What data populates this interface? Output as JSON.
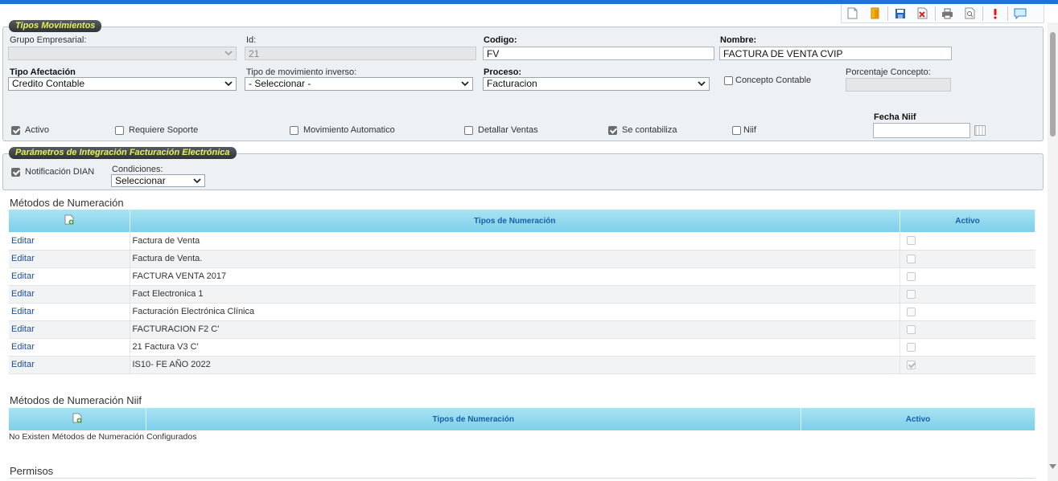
{
  "toolbar": {
    "icons": [
      "new-document-icon",
      "open-folder-icon",
      "save-icon",
      "delete-icon",
      "print-icon",
      "preview-icon",
      "alert-icon",
      "chat-icon"
    ]
  },
  "tipos": {
    "legend": "Tipos Movimientos",
    "grupo_label": "Grupo Empresarial:",
    "grupo_value": "",
    "id_label": "Id:",
    "id_value": "21",
    "codigo_label": "Codigo:",
    "codigo_value": "FV",
    "nombre_label": "Nombre:",
    "nombre_value": "FACTURA DE VENTA CVIP",
    "afectacion_label": "Tipo Afectación",
    "afectacion_value": "Credito Contable",
    "inverso_label": "Tipo de movimiento inverso:",
    "inverso_value": "- Seleccionar -",
    "proceso_label": "Proceso:",
    "proceso_value": "Facturacion",
    "concepto_contable_label": "Concepto Contable",
    "porcentaje_label": "Porcentaje Concepto:",
    "porcentaje_value": "",
    "fecha_niif_label": "Fecha Niif",
    "fecha_niif_value": "",
    "checks": [
      {
        "label": "Activo",
        "checked": true
      },
      {
        "label": "Requiere Soporte",
        "checked": false
      },
      {
        "label": "Movimiento Automatico",
        "checked": false
      },
      {
        "label": "Detallar Ventas",
        "checked": false
      },
      {
        "label": "Se contabiliza",
        "checked": true
      },
      {
        "label": "Niif",
        "checked": false
      }
    ]
  },
  "integracion": {
    "legend": "Parámetros de Integración Facturación Electrónica",
    "notificacion_label": "Notificación DIAN",
    "condiciones_label": "Condiciones:",
    "condiciones_value": "Seleccionar"
  },
  "numeracion": {
    "title": "Métodos de Numeración",
    "col_tipos": "Tipos de Numeración",
    "col_activo": "Activo",
    "rows": [
      {
        "action": "Editar",
        "name": "Factura de Venta",
        "activo": false
      },
      {
        "action": "Editar",
        "name": "Factura de Venta.",
        "activo": false
      },
      {
        "action": "Editar",
        "name": "FACTURA VENTA 2017",
        "activo": false
      },
      {
        "action": "Editar",
        "name": "Fact Electronica 1",
        "activo": false
      },
      {
        "action": "Editar",
        "name": "Facturación Electrónica Clínica",
        "activo": false
      },
      {
        "action": "Editar",
        "name": "FACTURACION F2 C'",
        "activo": false
      },
      {
        "action": "Editar",
        "name": "21 Factura V3 C'",
        "activo": false
      },
      {
        "action": "Editar",
        "name": "IS10- FE AÑO 2022",
        "activo": true
      }
    ]
  },
  "numeracion_niif": {
    "title": "Métodos de Numeración Niif",
    "col_tipos": "Tipos de Numeración",
    "col_activo": "Activo",
    "empty_text": "No Existen Métodos de Numeración Configurados"
  },
  "permisos": {
    "title": "Permisos"
  }
}
